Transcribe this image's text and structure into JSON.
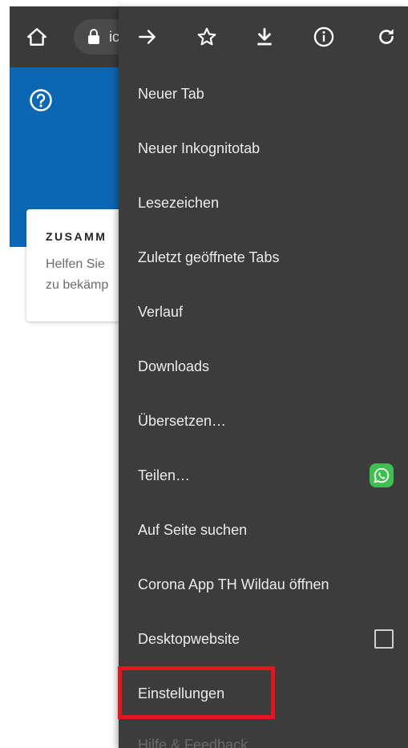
{
  "toolbar": {
    "url_text": "ic"
  },
  "card": {
    "title": "ZUSAMM",
    "line1": "Helfen Sie",
    "line2": "zu bekämp"
  },
  "menu": {
    "items": [
      {
        "label": "Neuer Tab"
      },
      {
        "label": "Neuer Inkognitotab"
      },
      {
        "label": "Lesezeichen"
      },
      {
        "label": "Zuletzt geöffnete Tabs"
      },
      {
        "label": "Verlauf"
      },
      {
        "label": "Downloads"
      },
      {
        "label": "Übersetzen…"
      },
      {
        "label": "Teilen…",
        "trailing": "whatsapp-icon"
      },
      {
        "label": "Auf Seite suchen"
      },
      {
        "label": "Corona App TH Wildau öffnen"
      },
      {
        "label": "Desktopwebsite",
        "trailing": "checkbox",
        "checked": false
      },
      {
        "label": "Einstellungen",
        "highlighted": true
      },
      {
        "label": "Hilfe & Feedback"
      }
    ]
  },
  "colors": {
    "toolbar": "#3a3a3b",
    "banner": "#0b67b3",
    "menu_bg": "#3c3c3d",
    "highlight_border": "#e8141b",
    "whatsapp": "#3cc04e"
  }
}
